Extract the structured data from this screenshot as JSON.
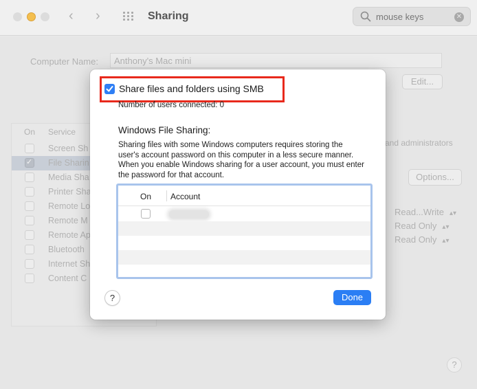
{
  "window": {
    "title": "Sharing",
    "search_value": "mouse keys"
  },
  "background": {
    "computer_name_label": "Computer Name:",
    "computer_name_value": "Anthony's Mac mini",
    "edit_label": "Edit...",
    "options_label": "Options...",
    "admin_text": "and administrators",
    "service_header_on": "On",
    "service_header_service": "Service",
    "services": [
      {
        "label": "Screen Sh",
        "checked": false,
        "selected": false
      },
      {
        "label": "File Sharin",
        "checked": true,
        "selected": true
      },
      {
        "label": "Media Sha",
        "checked": false,
        "selected": false
      },
      {
        "label": "Printer Sha",
        "checked": false,
        "selected": false
      },
      {
        "label": "Remote Lo",
        "checked": false,
        "selected": false
      },
      {
        "label": "Remote M",
        "checked": false,
        "selected": false
      },
      {
        "label": "Remote Ap",
        "checked": false,
        "selected": false
      },
      {
        "label": "Bluetooth",
        "checked": false,
        "selected": false
      },
      {
        "label": "Internet Sh",
        "checked": false,
        "selected": false
      },
      {
        "label": "Content C",
        "checked": false,
        "selected": false
      }
    ],
    "permissions": [
      "Read...Write",
      "Read Only",
      "Read Only"
    ],
    "help_label": "?"
  },
  "sheet": {
    "smb_label": "Share files and folders using SMB",
    "smb_checked": true,
    "users_connected": "Number of users connected: 0",
    "windows_title": "Windows File Sharing:",
    "windows_desc": "Sharing files with some Windows computers requires storing the user's account password on this computer in a less secure manner. When you enable Windows sharing for a user account, you must enter the password for that account.",
    "table": {
      "col_on": "On",
      "col_account": "Account",
      "rows": [
        {
          "checked": false
        }
      ]
    },
    "help_label": "?",
    "done_label": "Done"
  },
  "colors": {
    "accent": "#2b7ef4",
    "highlight_box": "#e8291c",
    "table_focus_ring": "#a8c4ec"
  }
}
